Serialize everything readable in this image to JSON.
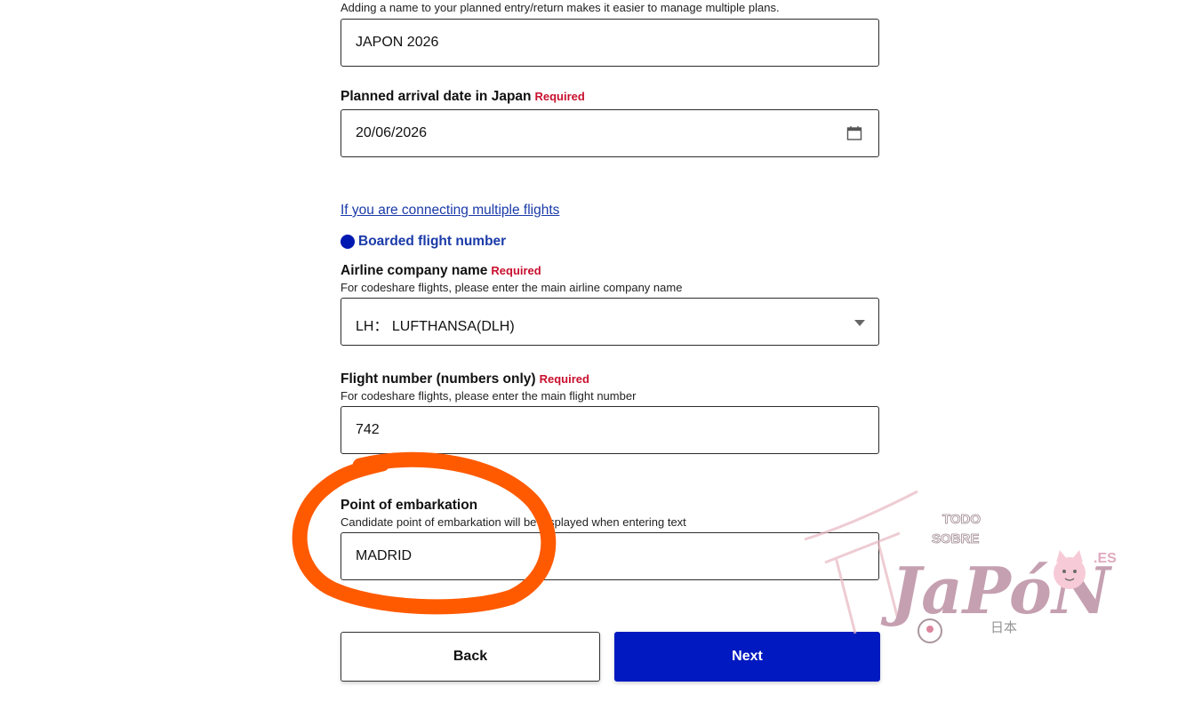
{
  "plan_name": {
    "hint": "Adding a name to your planned entry/return makes it easier to manage multiple plans.",
    "value": "JAPON 2026"
  },
  "arrival_date": {
    "label": "Planned arrival date in Japan",
    "required": "Required",
    "value": "20/06/2026",
    "icon": "calendar-icon"
  },
  "connecting_link": "If you are connecting multiple flights",
  "section_title": "Boarded flight number",
  "airline": {
    "label": "Airline company name",
    "required": "Required",
    "hint": "For codeshare flights, please enter the main airline company name",
    "value": "LH： LUFTHANSA(DLH)",
    "icon": "caret-down-icon"
  },
  "flight_number": {
    "label": "Flight number (numbers only)",
    "required": "Required",
    "hint": "For codeshare flights, please enter the main flight number",
    "value": "742"
  },
  "embarkation": {
    "label": "Point of embarkation",
    "hint": "Candidate point of embarkation will be displayed when entering text",
    "value": "MADRID"
  },
  "buttons": {
    "back": "Back",
    "next": "Next"
  },
  "watermark": {
    "top": "TODO",
    "mid": "SOBRE",
    "main": "JaPóN",
    "suffix": ".ES",
    "kanji": "日本"
  },
  "colors": {
    "accent": "#0019c0",
    "link": "#1a3aa8",
    "required": "#c8102e",
    "annotation": "#ff5a00"
  }
}
